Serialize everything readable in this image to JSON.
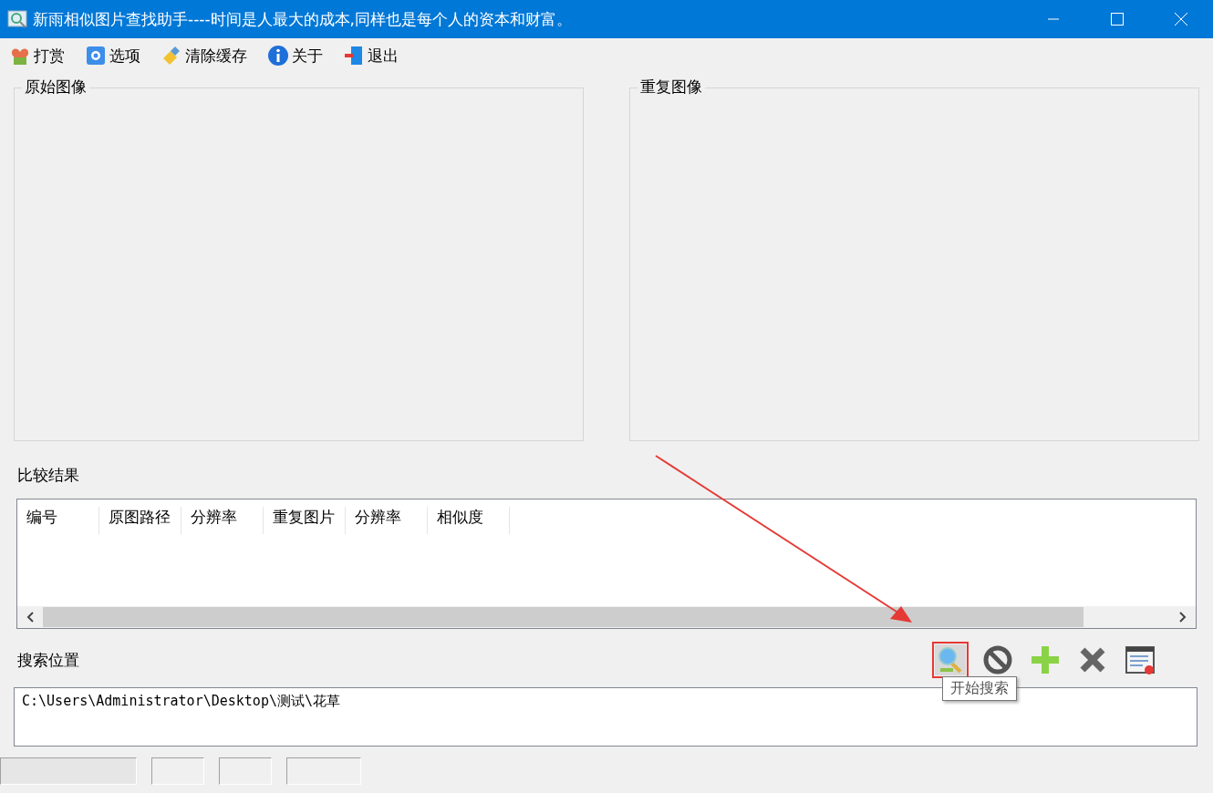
{
  "window": {
    "title": "新雨相似图片查找助手----时间是人最大的成本,同样也是每个人的资本和财富。"
  },
  "menu": [
    {
      "label": "打赏",
      "kind": "reward"
    },
    {
      "label": "选项",
      "kind": "options"
    },
    {
      "label": "清除缓存",
      "kind": "clean"
    },
    {
      "label": "关于",
      "kind": "about"
    },
    {
      "label": "退出",
      "kind": "exit"
    }
  ],
  "panels": [
    {
      "title": "原始图像"
    },
    {
      "title": "重复图像"
    }
  ],
  "results": {
    "title": "比较结果",
    "columns": [
      "编号",
      "原图路径",
      "分辨率",
      "重复图片",
      "分辨率",
      "相似度"
    ]
  },
  "search": {
    "title": "搜索位置",
    "tooltip": "开始搜索",
    "value": "C:\\Users\\Administrator\\Desktop\\测试\\花草",
    "tools": [
      {
        "kind": "search",
        "highlighted": true
      },
      {
        "kind": "stop",
        "highlighted": false
      },
      {
        "kind": "add",
        "highlighted": false
      },
      {
        "kind": "remove",
        "highlighted": false
      },
      {
        "kind": "clear",
        "highlighted": false
      }
    ]
  }
}
